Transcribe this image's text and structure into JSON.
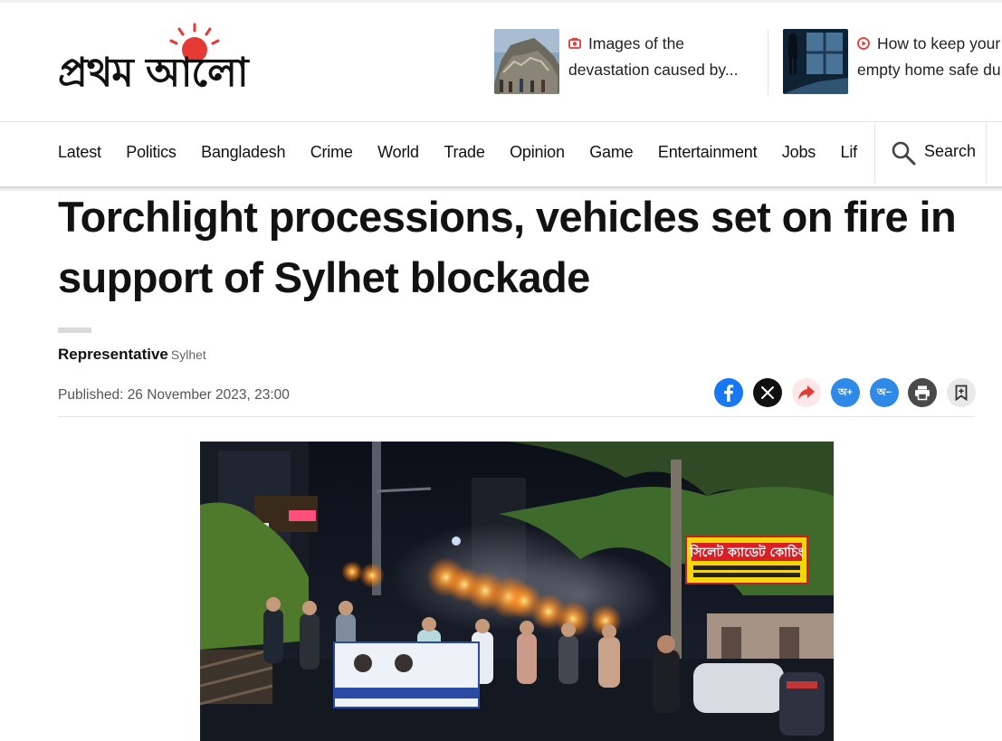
{
  "site": {
    "logo_alt": "প্রথম আলো",
    "logo_text": "প্রথম আলো"
  },
  "promos": [
    {
      "icon": "video-icon",
      "text": "Images of the",
      "text2": "devastation caused by..."
    },
    {
      "icon": "play-icon",
      "text": "How to keep your",
      "text2": "empty home safe du"
    }
  ],
  "nav": {
    "items": [
      "Latest",
      "Politics",
      "Bangladesh",
      "Crime",
      "World",
      "Trade",
      "Opinion",
      "Game",
      "Entertainment",
      "Jobs",
      "Lif"
    ],
    "search_label": "Search"
  },
  "article": {
    "headline": "Torchlight processions, vehicles set on fire in support of Sylhet blockade",
    "author": "Representative",
    "location": "Sylhet",
    "published": "Published: 26 November 2023, 23:00"
  },
  "share": {
    "font_increase": "অ+",
    "font_decrease": "অ−"
  },
  "hero_banner": {
    "text": "সিলেট ক্যাডেট কোচিং"
  },
  "colors": {
    "accent": "#e53935",
    "facebook": "#1877f2",
    "font_button": "#2e8ae6"
  }
}
